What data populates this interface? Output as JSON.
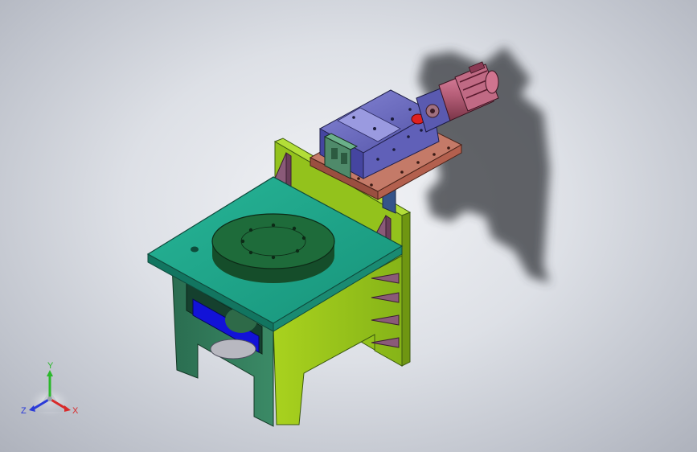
{
  "viewport": {
    "background_center": "#f2f3f6",
    "background_edge": "#aeb2bc"
  },
  "model": {
    "icon": "cad-assembly-model",
    "colors": {
      "tabletop": "#1fa58c",
      "turntable": "#1e6b3a",
      "frame_side_left": "#2e7a5a",
      "frame_side_right": "#98c31a",
      "back_plate": "#93c21c",
      "gusset": "#8a5a78",
      "slide_base": "#b06a5a",
      "slide_carriage": "#6f6fc0",
      "motor": "#b8607a",
      "motor_flange": "#5a5ab0",
      "inner_blue": "#1010d8",
      "shadow": "#3a3d42"
    }
  },
  "triad": {
    "icon": "coordinate-triad-icon",
    "axis_y_label": "Y",
    "axis_z_label": "Z",
    "axis_x_label": "X",
    "axis_y_color": "#2bb82b",
    "axis_z_color": "#2a3ad8",
    "axis_x_color": "#d82a2a"
  }
}
